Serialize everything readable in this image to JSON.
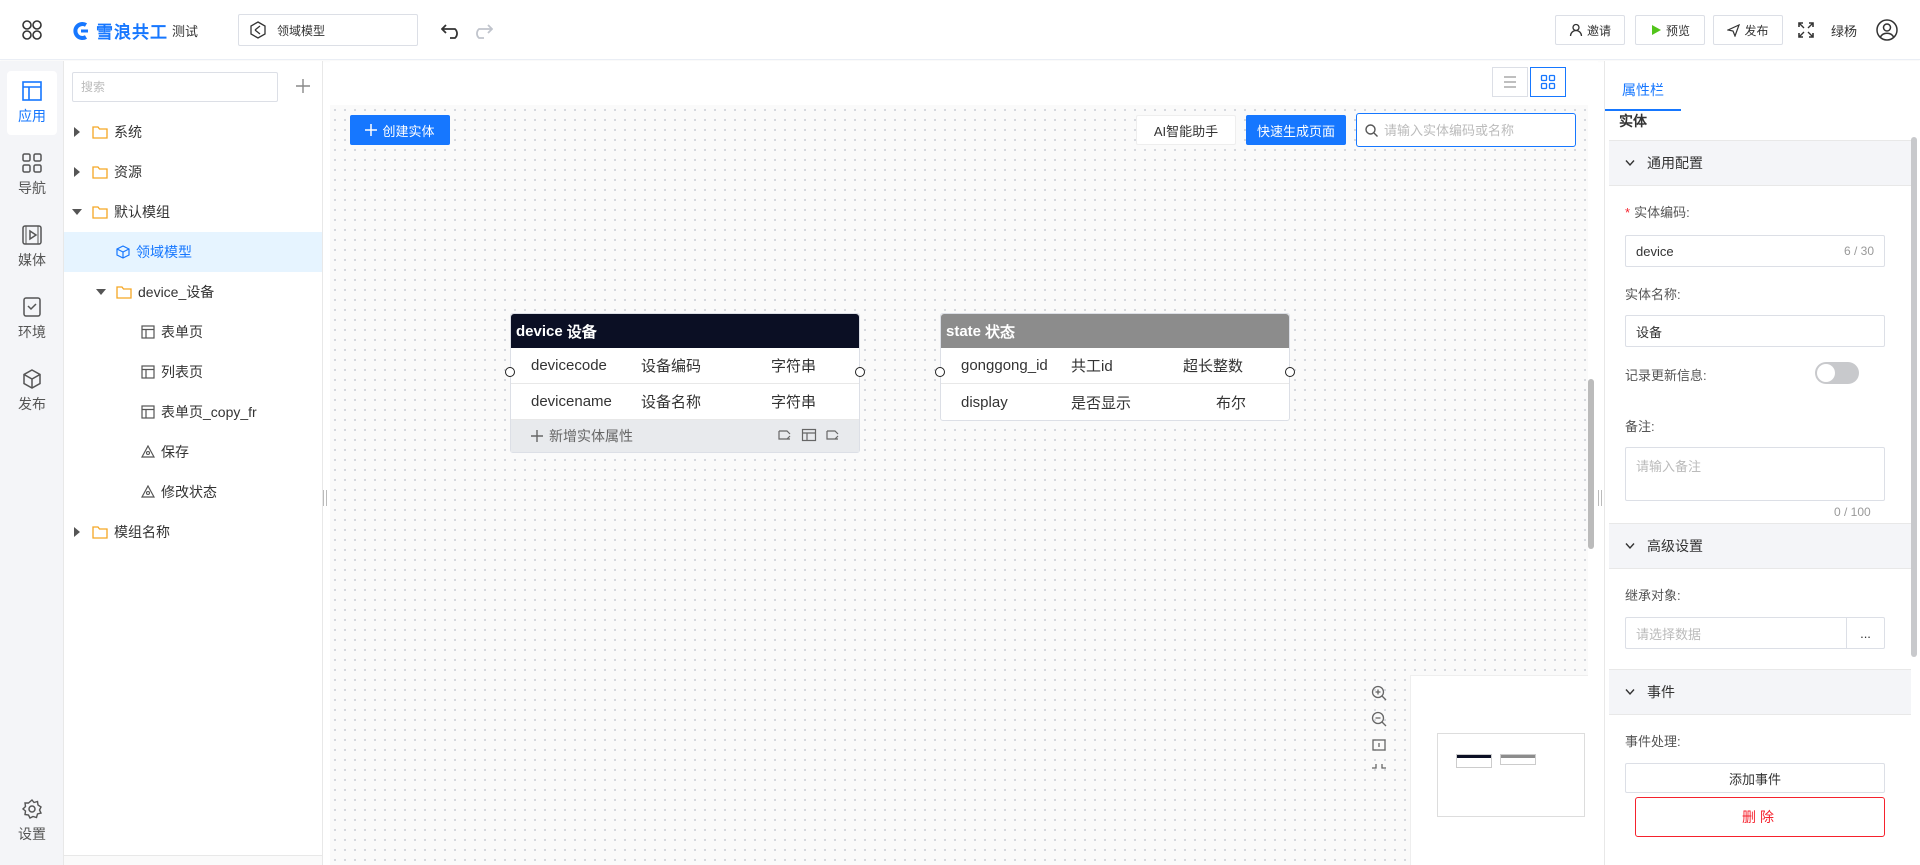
{
  "header": {
    "brand": "雪浪共工",
    "env": "测试",
    "page_select": "领域模型",
    "invite": "邀请",
    "preview": "预览",
    "publish": "发布",
    "username": "绿杨",
    "brand_color": "#1677ff"
  },
  "leftnav": [
    {
      "label": "应用",
      "icon": "app-layout-icon"
    },
    {
      "label": "导航",
      "icon": "grid-icon"
    },
    {
      "label": "媒体",
      "icon": "media-icon"
    },
    {
      "label": "环境",
      "icon": "env-icon"
    },
    {
      "label": "发布",
      "icon": "cube-icon"
    },
    {
      "label": "设置",
      "icon": "gear-icon"
    }
  ],
  "tree": {
    "search_placeholder": "搜索",
    "items": [
      {
        "label": "系统"
      },
      {
        "label": "资源"
      },
      {
        "label": "默认模组"
      },
      {
        "label": "领域模型"
      },
      {
        "label": "device_设备"
      },
      {
        "label": "表单页"
      },
      {
        "label": "列表页"
      },
      {
        "label": "表单页_copy_fr"
      },
      {
        "label": "保存"
      },
      {
        "label": "修改状态"
      },
      {
        "label": "模组名称"
      }
    ]
  },
  "canvas": {
    "create_label": "创建实体",
    "ai_label": "AI智能助手",
    "generate_label": "快速生成页面",
    "search_placeholder": "请输入实体编码或名称"
  },
  "entities": [
    {
      "code": "device",
      "name": "设备",
      "header_color": "#0b0f24",
      "fields": [
        {
          "code": "devicecode",
          "name": "设备编码",
          "type": "字符串"
        },
        {
          "code": "devicename",
          "name": "设备名称",
          "type": "字符串"
        }
      ],
      "add_label": "新增实体属性"
    },
    {
      "code": "state",
      "name": "状态",
      "header_color": "#8c8c8c",
      "fields": [
        {
          "code": "gonggong_id",
          "name": "共工id",
          "type": "超长整数"
        },
        {
          "code": "display",
          "name": "是否显示",
          "type": "布尔"
        }
      ]
    }
  ],
  "props": {
    "tab": "属性栏",
    "subtitle": "实体",
    "general_section": "通用配置",
    "code_label": "实体编码:",
    "code_value": "device",
    "code_count": "6 / 30",
    "name_label": "实体名称:",
    "name_value": "设备",
    "record_label": "记录更新信息:",
    "record_on": false,
    "remark_label": "备注:",
    "remark_placeholder": "请输入备注",
    "remark_count": "0 / 100",
    "advanced_section": "高级设置",
    "inherit_label": "继承对象:",
    "inherit_placeholder": "请选择数据",
    "inherit_more": "...",
    "event_section": "事件",
    "event_label": "事件处理:",
    "add_event": "添加事件",
    "delete": "删除",
    "danger_color": "#f5222d"
  }
}
